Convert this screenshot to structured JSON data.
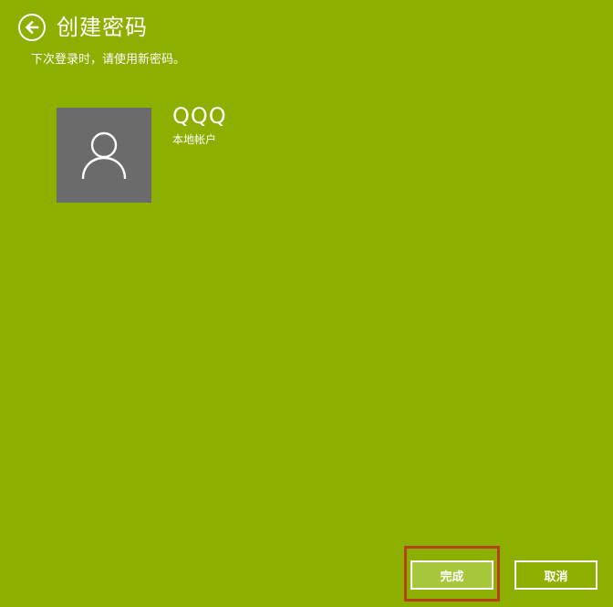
{
  "header": {
    "back_icon": "back-arrow-icon",
    "title": "创建密码"
  },
  "subtitle": "下次登录时，请使用新密码。",
  "account": {
    "avatar_icon": "user-icon",
    "name": "QQQ",
    "type": "本地帐户"
  },
  "buttons": {
    "done_label": "完成",
    "cancel_label": "取消"
  },
  "colors": {
    "background": "#8daf00",
    "avatar_bg": "#6b6b6b",
    "done_button_bg": "#a6c73a",
    "focus_ring": "#b5421a",
    "text": "#ffffff"
  }
}
